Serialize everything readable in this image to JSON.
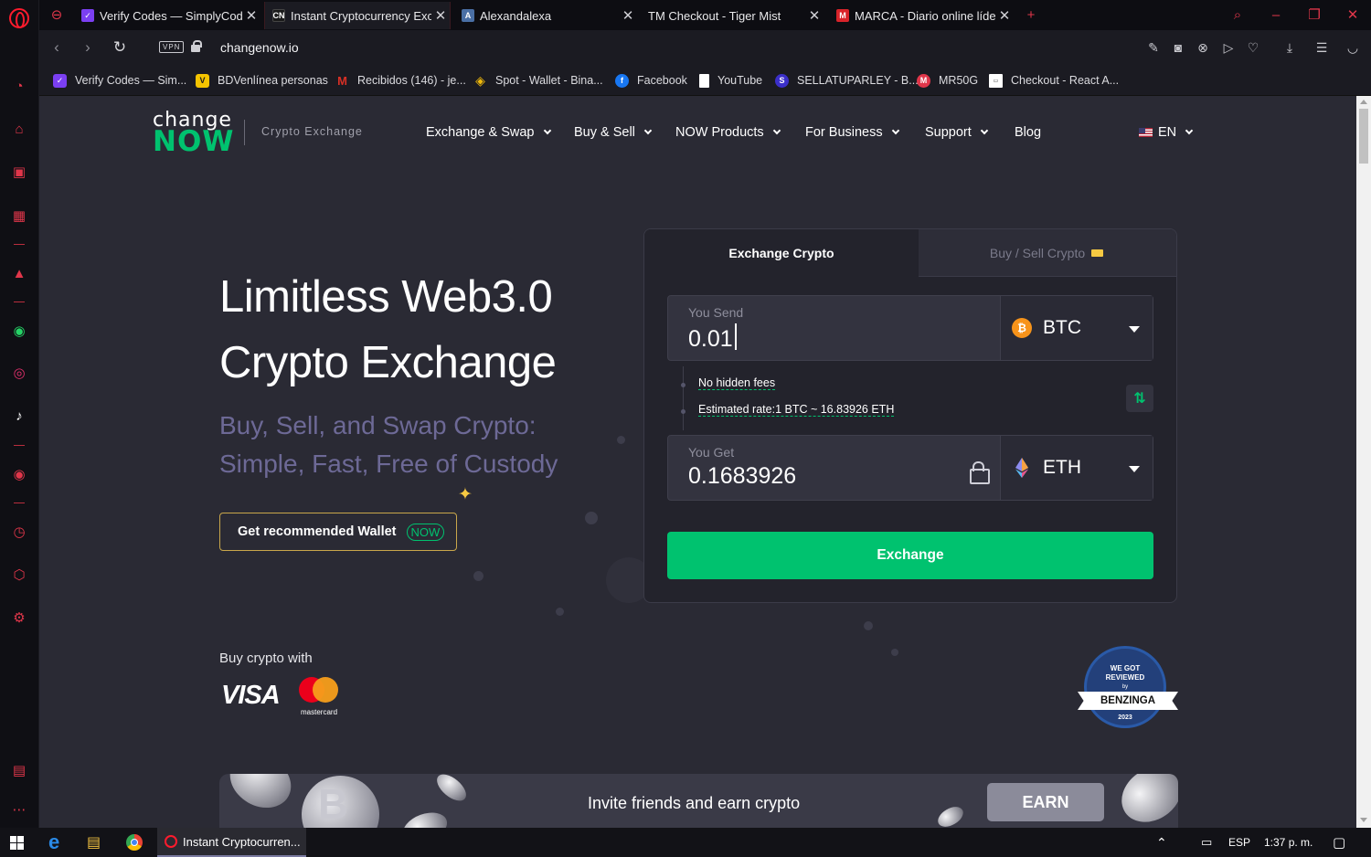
{
  "browser": {
    "tabs": [
      {
        "title": "Verify Codes — SimplyCodes",
        "active": false,
        "favicon": "simplycodes-icon",
        "color": "#7b3ff2"
      },
      {
        "title": "Instant Cryptocurrency Exchange",
        "active": true,
        "favicon": "changenow-icon",
        "color": "#1a1a1a"
      },
      {
        "title": "Alexandalexa",
        "active": false,
        "favicon": "alexa-icon",
        "color": "#4a6fa5"
      },
      {
        "title": "TM Checkout - Tiger Mist",
        "active": false,
        "favicon": "none",
        "color": "#1b1b22"
      },
      {
        "title": "MARCA - Diario online líder",
        "active": false,
        "favicon": "marca-icon",
        "color": "#d8232a"
      }
    ],
    "url": "changenow.io",
    "vpn_label": "VPN",
    "bookmarks": [
      {
        "label": "Verify Codes — Sim...",
        "icon": "simplycodes-icon",
        "color": "#7b3ff2"
      },
      {
        "label": "BDVenlínea personas",
        "icon": "bdv-icon",
        "color": "#f5c400"
      },
      {
        "label": "Recibidos (146) - je...",
        "icon": "gmail-icon",
        "color": "#d93025"
      },
      {
        "label": "Spot - Wallet - Bina...",
        "icon": "binance-icon",
        "color": "#f0b90b"
      },
      {
        "label": "Facebook",
        "icon": "facebook-icon",
        "color": "#1877f2"
      },
      {
        "label": "YouTube",
        "icon": "file-icon",
        "color": "#ffffff"
      },
      {
        "label": "SELLATUPARLEY - B...",
        "icon": "sellatuparley-icon",
        "color": "#3b2fc9"
      },
      {
        "label": "MR50G",
        "icon": "mr50g-icon",
        "color": "#e0364a"
      },
      {
        "label": "Checkout - React A...",
        "icon": "checkout-icon",
        "color": "#ffffff"
      }
    ]
  },
  "site": {
    "logo_top": "change",
    "logo_bottom": "NOW",
    "tagline": "Crypto Exchange",
    "nav": [
      {
        "label": "Exchange & Swap",
        "dropdown": true
      },
      {
        "label": "Buy & Sell",
        "dropdown": true
      },
      {
        "label": "NOW Products",
        "dropdown": true
      },
      {
        "label": "For Business",
        "dropdown": true
      },
      {
        "label": "Support",
        "dropdown": true
      },
      {
        "label": "Blog",
        "dropdown": false
      }
    ],
    "language": "EN",
    "hero_line1": "Limitless Web3.0",
    "hero_line2": "Crypto Exchange",
    "sub_line1": "Buy, Sell, and Swap Crypto:",
    "sub_line2": "Simple, Fast, Free of Custody",
    "wallet_button": "Get recommended Wallet",
    "wallet_tag": "NOW",
    "buy_with": "Buy crypto with",
    "visa": "VISA",
    "mastercard": "mastercard"
  },
  "widget": {
    "tab_exchange": "Exchange Crypto",
    "tab_buy": "Buy / Sell Crypto",
    "send_label": "You Send",
    "send_value": "0.01",
    "send_currency": "BTC",
    "no_fees": "No hidden fees",
    "rate": "Estimated rate:1 BTC ~ 16.83926 ETH",
    "get_label": "You Get",
    "get_value": "0.1683926",
    "get_currency": "ETH",
    "button": "Exchange"
  },
  "badge": {
    "line1": "WE GOT",
    "line2": "REVIEWED",
    "by": "by",
    "name": "BENZINGA",
    "year": "2023"
  },
  "banner": {
    "text": "Invite friends and earn crypto",
    "button": "EARN"
  },
  "taskbar": {
    "task_title": "Instant Cryptocurren...",
    "lang": "ESP",
    "time": "1:37 p. m."
  },
  "colors": {
    "brand_green": "#00c26f",
    "accent_red": "#e0364a",
    "page_bg": "#2a2a34",
    "widget_bg": "#23232c"
  }
}
